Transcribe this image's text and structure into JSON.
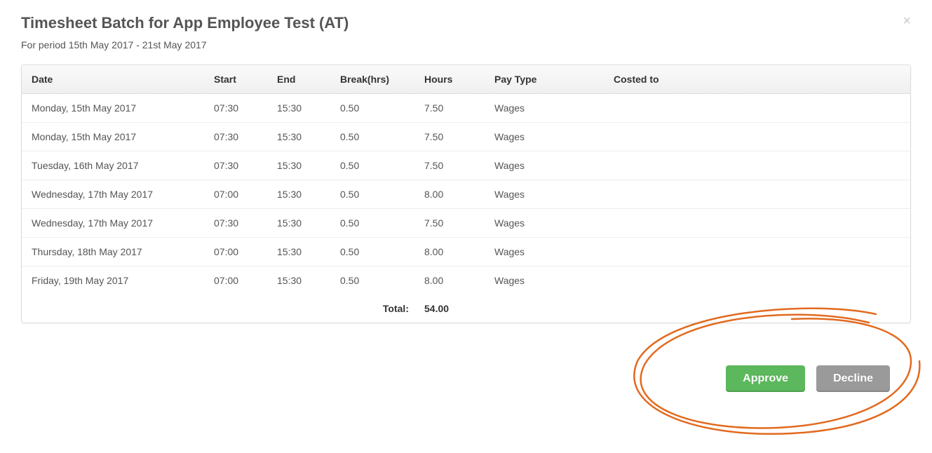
{
  "header": {
    "title": "Timesheet Batch for App Employee Test (AT)",
    "subtitle": "For period 15th May 2017 - 21st May 2017"
  },
  "table": {
    "columns": {
      "date": "Date",
      "start": "Start",
      "end": "End",
      "break": "Break(hrs)",
      "hours": "Hours",
      "payType": "Pay Type",
      "costedTo": "Costed to"
    },
    "rows": [
      {
        "date": "Monday, 15th May 2017",
        "start": "07:30",
        "end": "15:30",
        "break": "0.50",
        "hours": "7.50",
        "payType": "Wages",
        "costedTo": ""
      },
      {
        "date": "Monday, 15th May 2017",
        "start": "07:30",
        "end": "15:30",
        "break": "0.50",
        "hours": "7.50",
        "payType": "Wages",
        "costedTo": ""
      },
      {
        "date": "Tuesday, 16th May 2017",
        "start": "07:30",
        "end": "15:30",
        "break": "0.50",
        "hours": "7.50",
        "payType": "Wages",
        "costedTo": ""
      },
      {
        "date": "Wednesday, 17th May 2017",
        "start": "07:00",
        "end": "15:30",
        "break": "0.50",
        "hours": "8.00",
        "payType": "Wages",
        "costedTo": ""
      },
      {
        "date": "Wednesday, 17th May 2017",
        "start": "07:30",
        "end": "15:30",
        "break": "0.50",
        "hours": "7.50",
        "payType": "Wages",
        "costedTo": ""
      },
      {
        "date": "Thursday, 18th May 2017",
        "start": "07:00",
        "end": "15:30",
        "break": "0.50",
        "hours": "8.00",
        "payType": "Wages",
        "costedTo": ""
      },
      {
        "date": "Friday, 19th May 2017",
        "start": "07:00",
        "end": "15:30",
        "break": "0.50",
        "hours": "8.00",
        "payType": "Wages",
        "costedTo": ""
      }
    ],
    "total": {
      "label": "Total:",
      "value": "54.00"
    }
  },
  "actions": {
    "approve": "Approve",
    "decline": "Decline"
  }
}
